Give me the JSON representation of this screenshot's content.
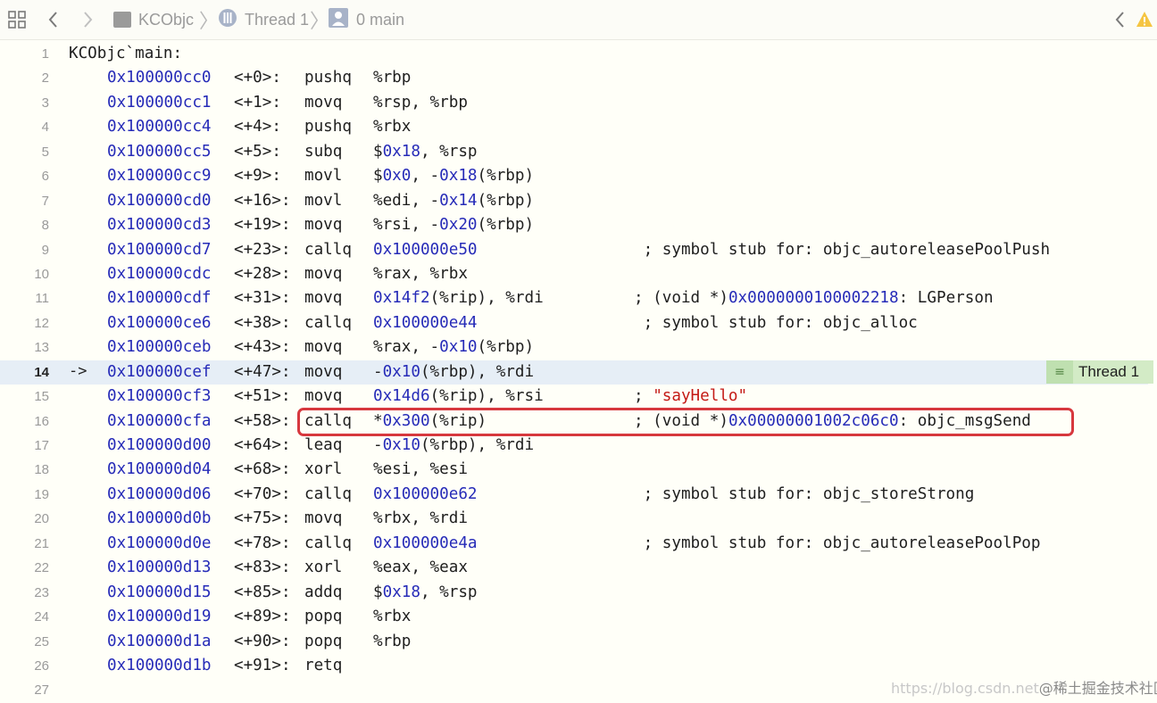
{
  "toolbar": {
    "breadcrumbs": [
      {
        "label": "KCObjc",
        "icon": "app-target-icon"
      },
      {
        "label": "Thread 1",
        "icon": "thread-icon"
      },
      {
        "label": "0 main",
        "icon": "stack-frame-icon"
      }
    ],
    "warning_icon": "warning-icon"
  },
  "disassembly": {
    "header": "KCObjc`main:",
    "current_line_marker": "->",
    "current_line": 14,
    "lines": [
      {
        "ln": "1"
      },
      {
        "ln": "2",
        "addr": "0x100000cc0",
        "off": "<+0>:",
        "op": "pushq",
        "args": "%rbp"
      },
      {
        "ln": "3",
        "addr": "0x100000cc1",
        "off": "<+1>:",
        "op": "movq",
        "args": "%rsp, %rbp"
      },
      {
        "ln": "4",
        "addr": "0x100000cc4",
        "off": "<+4>:",
        "op": "pushq",
        "args": "%rbx"
      },
      {
        "ln": "5",
        "addr": "0x100000cc5",
        "off": "<+5>:",
        "op": "subq",
        "args": "$0x18, %rsp"
      },
      {
        "ln": "6",
        "addr": "0x100000cc9",
        "off": "<+9>:",
        "op": "movl",
        "args": "$0x0, -0x18(%rbp)"
      },
      {
        "ln": "7",
        "addr": "0x100000cd0",
        "off": "<+16>:",
        "op": "movl",
        "args": "%edi, -0x14(%rbp)"
      },
      {
        "ln": "8",
        "addr": "0x100000cd3",
        "off": "<+19>:",
        "op": "movq",
        "args": "%rsi, -0x20(%rbp)"
      },
      {
        "ln": "9",
        "addr": "0x100000cd7",
        "off": "<+23>:",
        "op": "callq",
        "args": "0x100000e50",
        "comment": " ; symbol stub for: objc_autoreleasePoolPush"
      },
      {
        "ln": "10",
        "addr": "0x100000cdc",
        "off": "<+28>:",
        "op": "movq",
        "args": "%rax, %rbx"
      },
      {
        "ln": "11",
        "addr": "0x100000cdf",
        "off": "<+31>:",
        "op": "movq",
        "args": "0x14f2(%rip), %rdi",
        "comment": "; (void *)0x0000000100002218: LGPerson"
      },
      {
        "ln": "12",
        "addr": "0x100000ce6",
        "off": "<+38>:",
        "op": "callq",
        "args": "0x100000e44",
        "comment": " ; symbol stub for: objc_alloc"
      },
      {
        "ln": "13",
        "addr": "0x100000ceb",
        "off": "<+43>:",
        "op": "movq",
        "args": "%rax, -0x10(%rbp)"
      },
      {
        "ln": "14",
        "addr": "0x100000cef",
        "off": "<+47>:",
        "op": "movq",
        "args": "-0x10(%rbp), %rdi"
      },
      {
        "ln": "15",
        "addr": "0x100000cf3",
        "off": "<+51>:",
        "op": "movq",
        "args": "0x14d6(%rip), %rsi",
        "comment": "; \"sayHello\""
      },
      {
        "ln": "16",
        "addr": "0x100000cfa",
        "off": "<+58>:",
        "op": "callq",
        "args": "*0x300(%rip)",
        "comment": "; (void *)0x00000001002c06c0: objc_msgSend"
      },
      {
        "ln": "17",
        "addr": "0x100000d00",
        "off": "<+64>:",
        "op": "leaq",
        "args": "-0x10(%rbp), %rdi"
      },
      {
        "ln": "18",
        "addr": "0x100000d04",
        "off": "<+68>:",
        "op": "xorl",
        "args": "%esi, %esi"
      },
      {
        "ln": "19",
        "addr": "0x100000d06",
        "off": "<+70>:",
        "op": "callq",
        "args": "0x100000e62",
        "comment": " ; symbol stub for: objc_storeStrong"
      },
      {
        "ln": "20",
        "addr": "0x100000d0b",
        "off": "<+75>:",
        "op": "movq",
        "args": "%rbx, %rdi"
      },
      {
        "ln": "21",
        "addr": "0x100000d0e",
        "off": "<+78>:",
        "op": "callq",
        "args": "0x100000e4a",
        "comment": " ; symbol stub for: objc_autoreleasePoolPop"
      },
      {
        "ln": "22",
        "addr": "0x100000d13",
        "off": "<+83>:",
        "op": "xorl",
        "args": "%eax, %eax"
      },
      {
        "ln": "23",
        "addr": "0x100000d15",
        "off": "<+85>:",
        "op": "addq",
        "args": "$0x18, %rsp"
      },
      {
        "ln": "24",
        "addr": "0x100000d19",
        "off": "<+89>:",
        "op": "popq",
        "args": "%rbx"
      },
      {
        "ln": "25",
        "addr": "0x100000d1a",
        "off": "<+90>:",
        "op": "popq",
        "args": "%rbp"
      },
      {
        "ln": "26",
        "addr": "0x100000d1b",
        "off": "<+91>:",
        "op": "retq"
      },
      {
        "ln": "27"
      }
    ]
  },
  "thread_badge": {
    "label": "Thread 1",
    "icon": "thread-list-icon"
  },
  "watermark": {
    "url": "https://blog.csdn.net",
    "brand": "@稀土掘金技术社区"
  },
  "colors": {
    "number": "#262bb8",
    "string": "#c41a16",
    "highlight_border": "#d7383e",
    "current_line_bg": "#e6eef6",
    "badge_bg": "#d3ebc6"
  }
}
